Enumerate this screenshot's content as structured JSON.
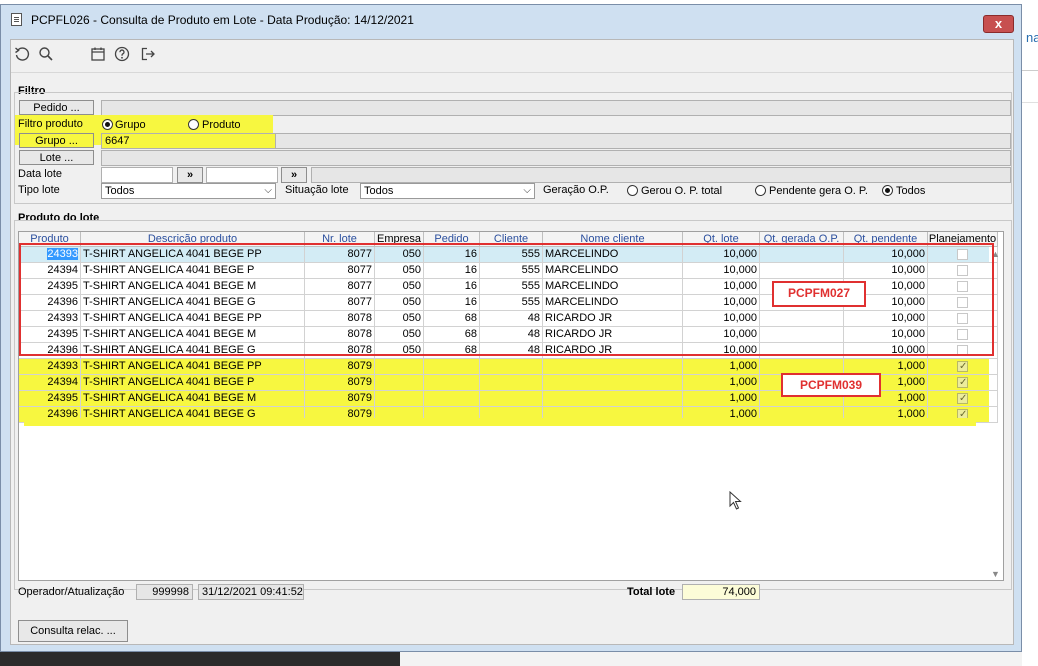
{
  "window": {
    "title": "PCPFL026 - Consulta de Produto em Lote - Data Produção: 14/12/2021",
    "close_label": "x"
  },
  "background": {
    "partial_text": "na"
  },
  "toolbar": {
    "icons": [
      "refresh-icon",
      "search-icon",
      "calendar-icon",
      "help-icon",
      "exit-icon"
    ]
  },
  "filtro": {
    "section_title": "Filtro",
    "pedido_button": "Pedido ...",
    "pedido_value": "",
    "filtro_produto_label": "Filtro produto",
    "radio_grupo": "Grupo",
    "radio_produto": "Produto",
    "selected_filter": "Grupo",
    "grupo_button": "Grupo ...",
    "grupo_value": "6647",
    "lote_button": "Lote ...",
    "lote_value": "",
    "data_lote_label": "Data lote",
    "date_from": "",
    "date_to": "",
    "date_btn": "»",
    "tipo_lote_label": "Tipo lote",
    "tipo_lote_value": "Todos",
    "situacao_lote_label": "Situação lote",
    "situacao_lote_value": "Todos",
    "geracao_op_label": "Geração O.P.",
    "radio_gerou": "Gerou O. P. total",
    "radio_pendente": "Pendente gera O. P.",
    "radio_todos": "Todos",
    "selected_geracao": "Todos"
  },
  "produto_lote": {
    "section_title": "Produto do lote",
    "columns": [
      "Produto",
      "Descrição produto",
      "Nr. lote",
      "Empresa",
      "Pedido",
      "Cliente",
      "Nome cliente",
      "Qt. lote",
      "Qt. gerada O.P.",
      "Qt. pendente",
      "Planejamento"
    ],
    "rows": [
      {
        "produto": "24393",
        "descricao": "T-SHIRT ANGELICA 4041 BEGE PP",
        "lote": "8077",
        "empresa": "050",
        "pedido": "16",
        "cliente": "555",
        "nome": "MARCELINDO",
        "qt_lote": "10,000",
        "qt_gerada": "",
        "qt_pendente": "10,000",
        "planejamento": false
      },
      {
        "produto": "24394",
        "descricao": "T-SHIRT ANGELICA 4041 BEGE P",
        "lote": "8077",
        "empresa": "050",
        "pedido": "16",
        "cliente": "555",
        "nome": "MARCELINDO",
        "qt_lote": "10,000",
        "qt_gerada": "",
        "qt_pendente": "10,000",
        "planejamento": false
      },
      {
        "produto": "24395",
        "descricao": "T-SHIRT ANGELICA 4041 BEGE M",
        "lote": "8077",
        "empresa": "050",
        "pedido": "16",
        "cliente": "555",
        "nome": "MARCELINDO",
        "qt_lote": "10,000",
        "qt_gerada": "",
        "qt_pendente": "10,000",
        "planejamento": false
      },
      {
        "produto": "24396",
        "descricao": "T-SHIRT ANGELICA 4041 BEGE G",
        "lote": "8077",
        "empresa": "050",
        "pedido": "16",
        "cliente": "555",
        "nome": "MARCELINDO",
        "qt_lote": "10,000",
        "qt_gerada": "",
        "qt_pendente": "10,000",
        "planejamento": false
      },
      {
        "produto": "24393",
        "descricao": "T-SHIRT ANGELICA 4041 BEGE PP",
        "lote": "8078",
        "empresa": "050",
        "pedido": "68",
        "cliente": "48",
        "nome": "RICARDO JR",
        "qt_lote": "10,000",
        "qt_gerada": "",
        "qt_pendente": "10,000",
        "planejamento": false
      },
      {
        "produto": "24395",
        "descricao": "T-SHIRT ANGELICA 4041 BEGE M",
        "lote": "8078",
        "empresa": "050",
        "pedido": "68",
        "cliente": "48",
        "nome": "RICARDO JR",
        "qt_lote": "10,000",
        "qt_gerada": "",
        "qt_pendente": "10,000",
        "planejamento": false
      },
      {
        "produto": "24396",
        "descricao": "T-SHIRT ANGELICA 4041 BEGE G",
        "lote": "8078",
        "empresa": "050",
        "pedido": "68",
        "cliente": "48",
        "nome": "RICARDO JR",
        "qt_lote": "10,000",
        "qt_gerada": "",
        "qt_pendente": "10,000",
        "planejamento": false
      },
      {
        "produto": "24393",
        "descricao": "T-SHIRT ANGELICA 4041 BEGE PP",
        "lote": "8079",
        "empresa": "",
        "pedido": "",
        "cliente": "",
        "nome": "",
        "qt_lote": "1,000",
        "qt_gerada": "",
        "qt_pendente": "1,000",
        "planejamento": true
      },
      {
        "produto": "24394",
        "descricao": "T-SHIRT ANGELICA 4041 BEGE P",
        "lote": "8079",
        "empresa": "",
        "pedido": "",
        "cliente": "",
        "nome": "",
        "qt_lote": "1,000",
        "qt_gerada": "",
        "qt_pendente": "1,000",
        "planejamento": true
      },
      {
        "produto": "24395",
        "descricao": "T-SHIRT ANGELICA 4041 BEGE M",
        "lote": "8079",
        "empresa": "",
        "pedido": "",
        "cliente": "",
        "nome": "",
        "qt_lote": "1,000",
        "qt_gerada": "",
        "qt_pendente": "1,000",
        "planejamento": true
      },
      {
        "produto": "24396",
        "descricao": "T-SHIRT ANGELICA 4041 BEGE G",
        "lote": "8079",
        "empresa": "",
        "pedido": "",
        "cliente": "",
        "nome": "",
        "qt_lote": "1,000",
        "qt_gerada": "",
        "qt_pendente": "1,000",
        "planejamento": true
      }
    ],
    "annotation_1": "PCPFM027",
    "annotation_2": "PCPFM039"
  },
  "footer": {
    "operador_label": "Operador/Atualização",
    "operador_value": "999998",
    "atualizacao_value": "31/12/2021 09:41:52",
    "total_lote_label": "Total lote",
    "total_lote_value": "74,000",
    "consulta_button": "Consulta relac. ..."
  },
  "colors": {
    "highlight_yellow": "#f7f740",
    "annotation_red": "#e03030",
    "selection_blue": "#3399ff",
    "link_blue": "#2b4f9e"
  }
}
